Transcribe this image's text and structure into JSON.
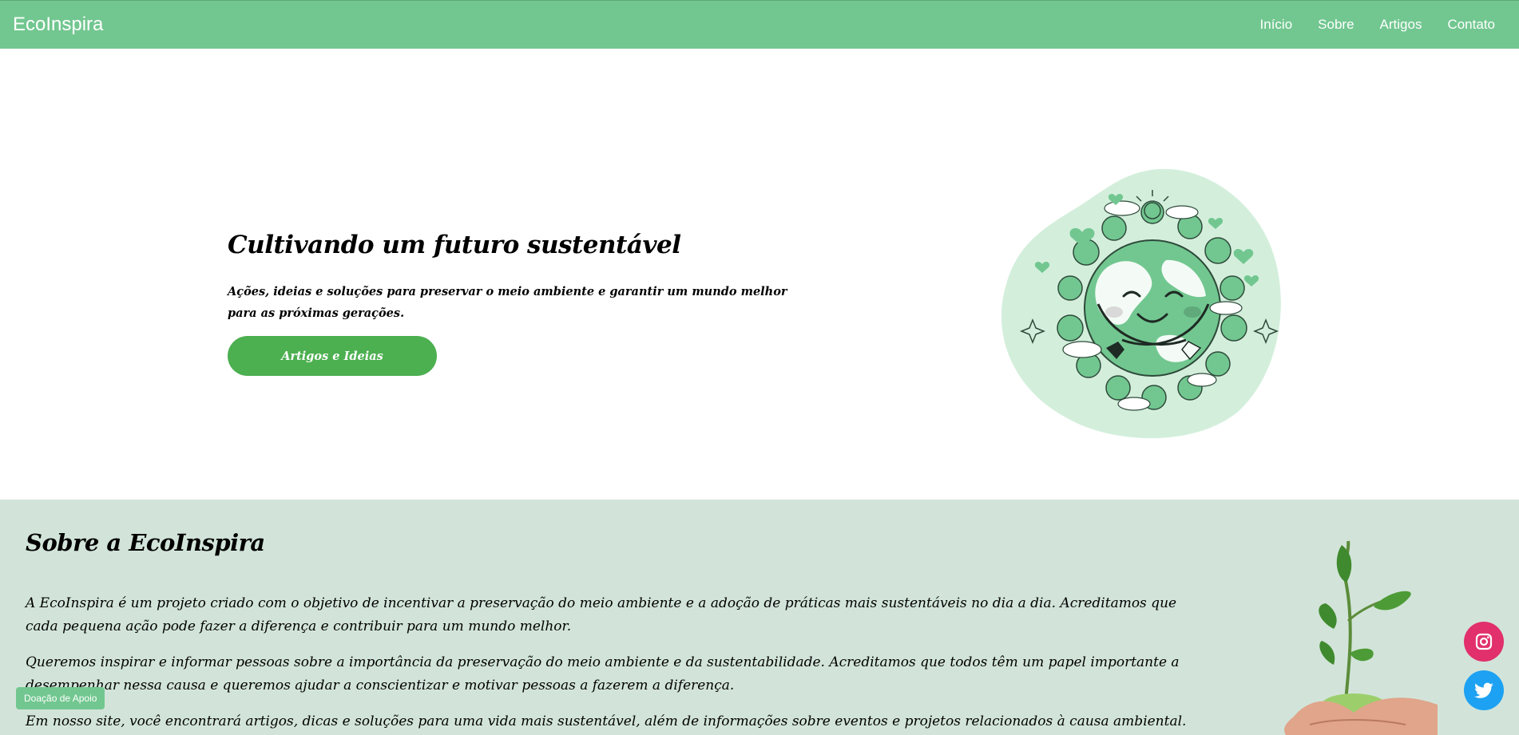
{
  "nav": {
    "brand": "EcoInspira",
    "links": [
      "Início",
      "Sobre",
      "Artigos",
      "Contato"
    ]
  },
  "hero": {
    "title": "Cultivando um futuro sustentável",
    "subtitle": "Ações, ideias e soluções para preservar o meio ambiente e garantir um mundo melhor para as próximas gerações.",
    "button": "Artigos e Ideias"
  },
  "about": {
    "title": "Sobre a EcoInspira",
    "paragraphs": [
      "A EcoInspira é um projeto criado com o objetivo de incentivar a preservação do meio ambiente e a adoção de práticas mais sustentáveis no dia a dia. Acreditamos que cada pequena ação pode fazer a diferença e contribuir para um mundo melhor.",
      "Queremos inspirar e informar pessoas sobre a importância da preservação do meio ambiente e da sustentabilidade. Acreditamos que todos têm um papel importante a desempenhar nessa causa e queremos ajudar a conscientizar e motivar pessoas a fazerem a diferença.",
      "Em nosso site, você encontrará artigos, dicas e soluções para uma vida mais sustentável, além de informações sobre eventos e projetos relacionados à causa ambiental. Junte-se a nós e"
    ]
  },
  "floating": {
    "donate": "Doação de Apoio",
    "instagram_icon": "instagram-icon",
    "twitter_icon": "twitter-icon"
  },
  "colors": {
    "navbar": "#72c790",
    "button": "#4caf50",
    "about_bg": "#d2e4d9",
    "instagram": "#e1306c",
    "twitter": "#1da1f2"
  }
}
